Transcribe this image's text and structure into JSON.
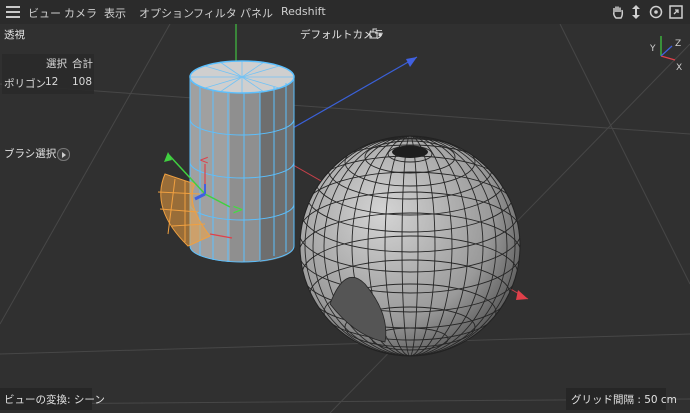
{
  "menu": {
    "items": [
      {
        "label": "ビュー"
      },
      {
        "label": "カメラ"
      },
      {
        "label": "表示"
      },
      {
        "label": "オプション"
      },
      {
        "label": "フィルタ"
      },
      {
        "label": "パネル"
      },
      {
        "label": "Redshift"
      }
    ],
    "nav_icons": [
      "hand-pan-icon",
      "move-arrows-icon",
      "rotate-icon",
      "maximize-icon"
    ]
  },
  "viewport": {
    "view_name": "透視",
    "camera": "デフォルトカメラ",
    "camera_icon": "camera-link-icon",
    "stats": {
      "header_selected": "選択",
      "header_total": "合計",
      "row_label": "ポリゴン",
      "selected": "12",
      "total": "108"
    },
    "brush_label": "ブラシ選択",
    "transform_label": "ビューの変換: シーン",
    "grid_label": "グリッド間隔 : 50 cm",
    "gizmo_axes": [
      "Y",
      "Z",
      "X"
    ]
  },
  "colors": {
    "background": "#303030",
    "menubar": "#2b2b2b",
    "selection": "#5bc0ff",
    "polygon_highlight": "#f0a040",
    "axis_x": "#e0404a",
    "axis_y": "#40d040",
    "axis_z": "#4060e0"
  }
}
